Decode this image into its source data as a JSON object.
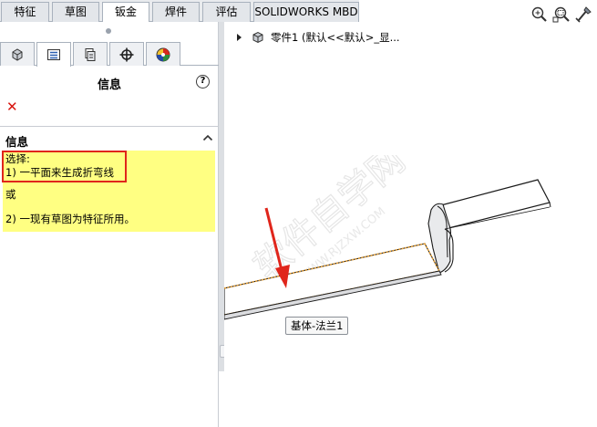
{
  "tabs": [
    {
      "label": "特征",
      "active": false
    },
    {
      "label": "草图",
      "active": false
    },
    {
      "label": "钣金",
      "active": true
    },
    {
      "label": "焊件",
      "active": false
    },
    {
      "label": "评估",
      "active": false
    },
    {
      "label": "SOLIDWORKS MBD",
      "active": false
    }
  ],
  "panel": {
    "icon_tabs": [
      "feature-manager-icon",
      "property-manager-icon",
      "configuration-manager-icon",
      "dimxpert-icon",
      "display-manager-icon"
    ],
    "title": "信息",
    "help_label": "?",
    "cancel_label": "✕",
    "section": {
      "title": "信息",
      "lines": [
        "选择:",
        "1) 一平面来生成折弯线",
        "或",
        "2) 一现有草图为特征所用。"
      ]
    }
  },
  "viewport": {
    "tree_label": "零件1  (默认<<默认>_显...",
    "tooltip": "基体-法兰1",
    "view_icons": [
      "zoom-to-fit-icon",
      "zoom-to-area-icon",
      "previous-view-icon"
    ],
    "watermark": [
      "软件自学网",
      "WWW.RJZXW.COM"
    ]
  },
  "colors": {
    "message_bg": "#ffff82",
    "highlight_box": "#e0251b",
    "arrow": "#e0251b",
    "edge_highlight": "#e8a33a"
  }
}
